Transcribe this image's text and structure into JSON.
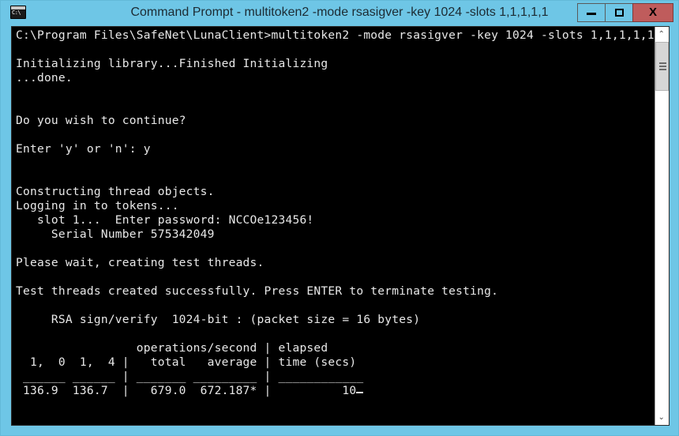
{
  "window": {
    "title": "Command Prompt - multitoken2  -mode rsasigver -key 1024 -slots 1,1,1,1,1",
    "icon_name": "cmd-console-icon",
    "icon_text": "C:\\",
    "titlebar_color": "#6ec6e6",
    "console_bg": "#000000",
    "console_fg": "#e8e8e8",
    "close_button_color": "#bf5c5c"
  },
  "controls": {
    "minimize_label": "—",
    "maximize_label": "□",
    "close_label": "X"
  },
  "scrollbar": {
    "up_arrow": "⌃",
    "down_arrow": "⌄"
  },
  "console": {
    "lines": [
      "C:\\Program Files\\SafeNet\\LunaClient>multitoken2 -mode rsasigver -key 1024 -slots 1,1,1,1,1",
      "",
      "Initializing library...Finished Initializing",
      "...done.",
      "",
      "",
      "Do you wish to continue?",
      "",
      "Enter 'y' or 'n': y",
      "",
      "",
      "Constructing thread objects.",
      "Logging in to tokens...",
      "   slot 1...  Enter password: NCCOe123456!",
      "     Serial Number 575342049",
      "",
      "Please wait, creating test threads.",
      "",
      "Test threads created successfully. Press ENTER to terminate testing.",
      "",
      "     RSA sign/verify  1024-bit : (packet size = 16 bytes)",
      "",
      "                 operations/second | elapsed",
      "  1,  0  1,  4 |   total   average | time (secs)",
      " ______ ______ | _______ _________ | ____________",
      " 136.9  136.7  |   679.0  672.187* |          10"
    ],
    "command": {
      "prompt_path": "C:\\Program Files\\SafeNet\\LunaClient>",
      "executable": "multitoken2",
      "mode": "rsasigver",
      "key": "1024",
      "slots": "1,1,1,1,1"
    },
    "prompts": {
      "continue_question": "Do you wish to continue?",
      "continue_prompt": "Enter 'y' or 'n': y",
      "password_prompt": "slot 1...  Enter password:",
      "password_value": "NCCOe123456!",
      "serial_number_label": "Serial Number",
      "serial_number": "575342049",
      "terminate_hint": "Test threads created successfully. Press ENTER to terminate testing."
    },
    "test_header": {
      "algorithm": "RSA sign/verify",
      "key_size": "1024-bit",
      "packet_size": "(packet size = 16 bytes)"
    },
    "results_table": {
      "group_headers": [
        "operations/second",
        "elapsed"
      ],
      "columns": [
        "1,  0",
        "1,  4",
        "total",
        "average",
        "time (secs)"
      ],
      "row": [
        "136.9",
        "136.7",
        "679.0",
        "672.187*",
        "10"
      ]
    },
    "cursor_visible": true
  }
}
